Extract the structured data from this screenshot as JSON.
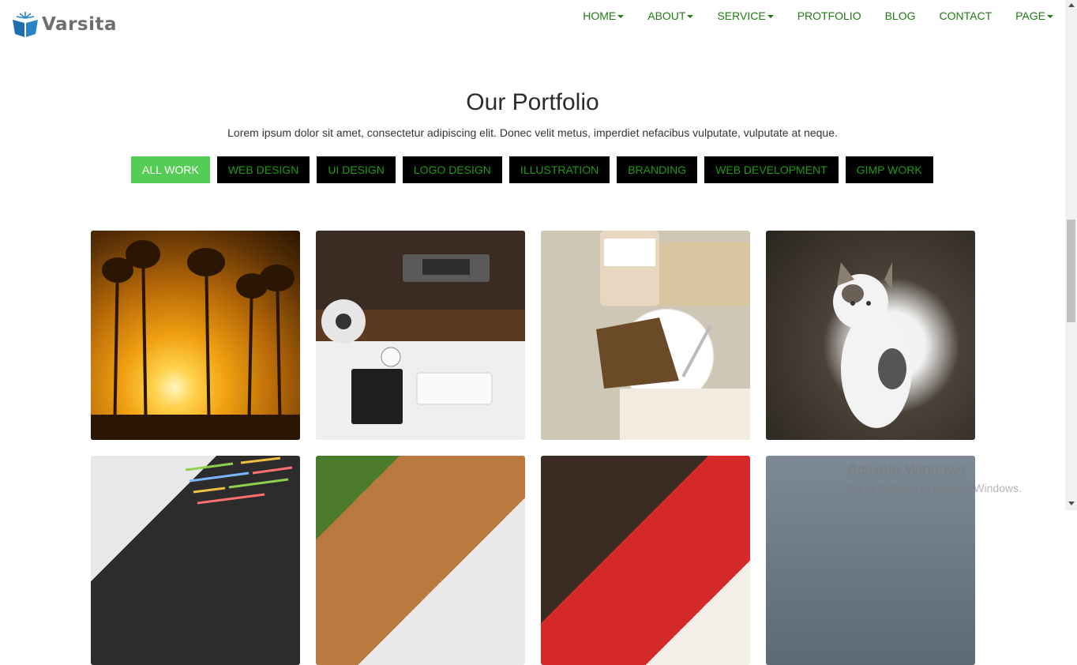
{
  "brand": {
    "name": "Varsita",
    "logo_icon": "book-icon",
    "accent": "#1f7aa8"
  },
  "nav": {
    "items": [
      {
        "label": "HOME",
        "dropdown": true
      },
      {
        "label": "ABOUT",
        "dropdown": true
      },
      {
        "label": "SERVICE",
        "dropdown": true
      },
      {
        "label": "PROTFOLIO",
        "dropdown": false
      },
      {
        "label": "BLOG",
        "dropdown": false
      },
      {
        "label": "CONTACT",
        "dropdown": false
      },
      {
        "label": "PAGE",
        "dropdown": true
      }
    ],
    "color": "#1f7a12"
  },
  "portfolio": {
    "title": "Our Portfolio",
    "subtitle": "Lorem ipsum dolor sit amet, consectetur adipiscing elit. Donec velit metus, imperdiet nefacibus vulputate, vulputate at neque.",
    "filters": [
      {
        "label": "ALL WORK",
        "active": true
      },
      {
        "label": "WEB DESIGN",
        "active": false
      },
      {
        "label": "UI DESIGN",
        "active": false
      },
      {
        "label": "LOGO DESIGN",
        "active": false
      },
      {
        "label": "ILLUSTRATION",
        "active": false
      },
      {
        "label": "BRANDING",
        "active": false
      },
      {
        "label": "WEB DEVELOPMENT",
        "active": false
      },
      {
        "label": "GIMP WORK",
        "active": false
      }
    ],
    "active_color": "#55cc55",
    "filter_text_color": "#1f9a14"
  },
  "watermark": {
    "line1": "Activate Windows",
    "line2": "Go to Settings to activate Windows."
  }
}
